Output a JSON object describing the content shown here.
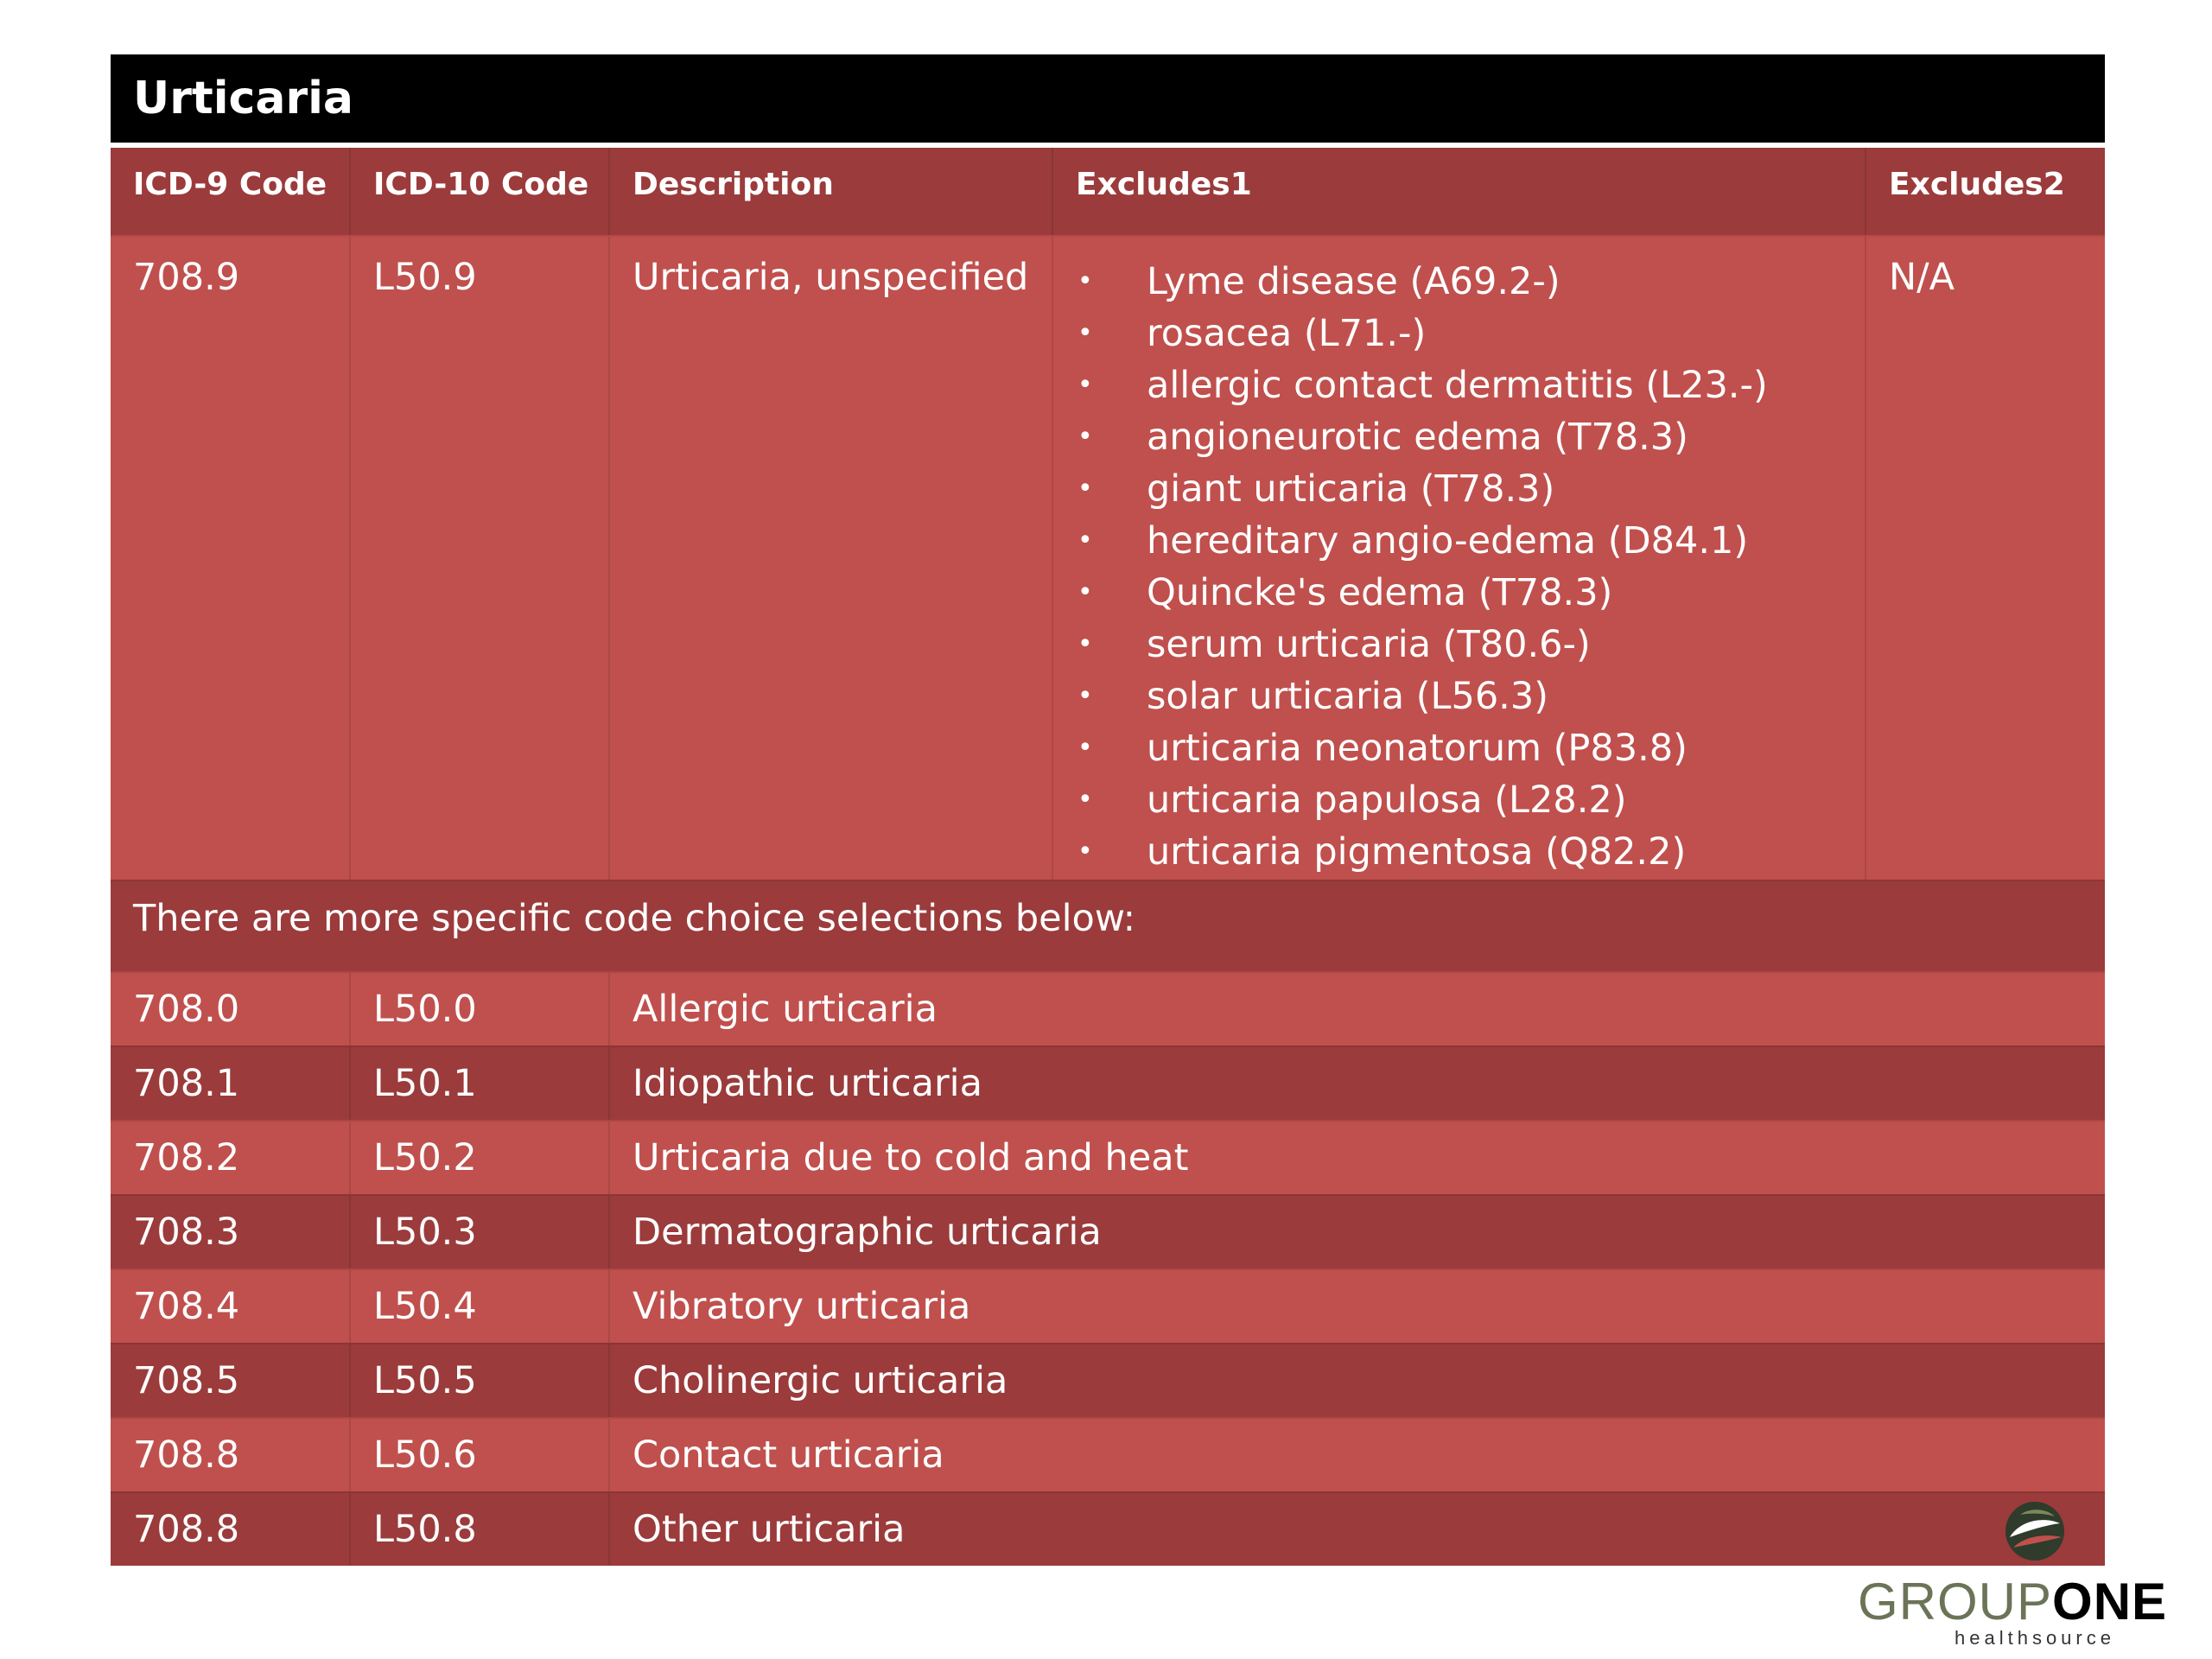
{
  "title": "Urticaria",
  "columns": [
    "ICD-9 Code",
    "ICD-10 Code",
    "Description",
    "Excludes1",
    "Excludes2"
  ],
  "main_entry": {
    "icd9": "708.9",
    "icd10": "L50.9",
    "description": "Urticaria, unspecified",
    "excludes1": [
      "Lyme disease (A69.2-)",
      "rosacea (L71.-)",
      "allergic contact dermatitis (L23.-)",
      "angioneurotic edema (T78.3)",
      "giant urticaria (T78.3)",
      "hereditary angio-edema (D84.1)",
      "Quincke's edema (T78.3)",
      "serum urticaria (T80.6-)",
      "solar urticaria (L56.3)",
      "urticaria neonatorum (P83.8)",
      "urticaria papulosa (L28.2)",
      "urticaria pigmentosa (Q82.2)"
    ],
    "excludes2": "N/A"
  },
  "note": "There are more specific code choice selections below:",
  "specific_codes": [
    {
      "icd9": "708.0",
      "icd10": "L50.0",
      "description": "Allergic urticaria"
    },
    {
      "icd9": "708.1",
      "icd10": "L50.1",
      "description": "Idiopathic urticaria"
    },
    {
      "icd9": "708.2",
      "icd10": "L50.2",
      "description": "Urticaria due to cold and heat"
    },
    {
      "icd9": "708.3",
      "icd10": "L50.3",
      "description": "Dermatographic urticaria"
    },
    {
      "icd9": "708.4",
      "icd10": "L50.4",
      "description": "Vibratory urticaria"
    },
    {
      "icd9": "708.5",
      "icd10": "L50.5",
      "description": "Cholinergic urticaria"
    },
    {
      "icd9": "708.8",
      "icd10": "L50.6",
      "description": "Contact urticaria"
    },
    {
      "icd9": "708.8",
      "icd10": "L50.8",
      "description": "Other urticaria"
    }
  ],
  "bullet_char": "•",
  "logo": {
    "text_light": "GROUP",
    "text_bold": "ONE",
    "subtext": "healthsource"
  },
  "colors": {
    "title_bg": "#000000",
    "row_light": "#c0504d",
    "row_dark": "#9b3b3b"
  }
}
